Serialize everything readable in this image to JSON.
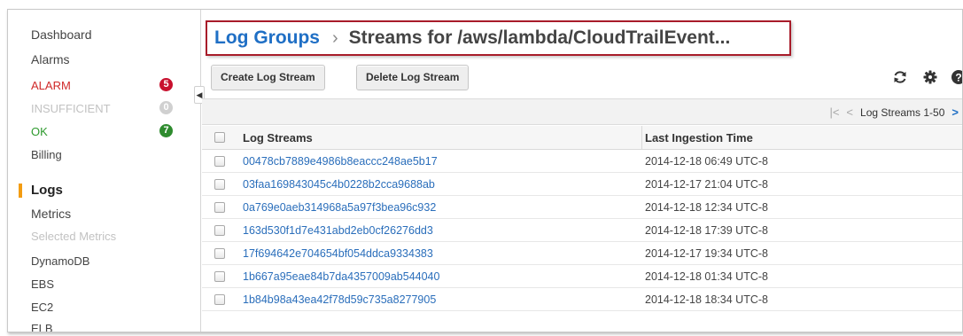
{
  "sidebar": {
    "dashboard": "Dashboard",
    "alarms": "Alarms",
    "alarm_states": [
      {
        "label": "ALARM",
        "count": "5"
      },
      {
        "label": "INSUFFICIENT",
        "count": "0"
      },
      {
        "label": "OK",
        "count": "7"
      }
    ],
    "billing": "Billing",
    "logs": "Logs",
    "metrics": "Metrics",
    "selected_metrics": "Selected Metrics",
    "metric_items": [
      "DynamoDB",
      "EBS",
      "EC2",
      "ELB"
    ],
    "collapse_glyph": "◀"
  },
  "breadcrumb": {
    "parent": "Log Groups",
    "separator": "›",
    "current": "Streams for /aws/lambda/CloudTrailEvent..."
  },
  "toolbar": {
    "create_label": "Create Log Stream",
    "delete_label": "Delete Log Stream"
  },
  "pager": {
    "first": "|<",
    "prev": "<",
    "range_label": "Log Streams 1-50",
    "next": ">"
  },
  "table": {
    "columns": [
      "Log Streams",
      "Last Ingestion Time"
    ],
    "rows": [
      {
        "stream": "00478cb7889e4986b8eaccc248ae5b17",
        "time": "2014-12-18 06:49 UTC-8"
      },
      {
        "stream": "03faa169843045c4b0228b2cca9688ab",
        "time": "2014-12-17 21:04 UTC-8"
      },
      {
        "stream": "0a769e0aeb314968a5a97f3bea96c932",
        "time": "2014-12-18 12:34 UTC-8"
      },
      {
        "stream": "163d530f1d7e431abd2eb0cf26276dd3",
        "time": "2014-12-18 17:39 UTC-8"
      },
      {
        "stream": "17f694642e704654bf054ddca9334383",
        "time": "2014-12-17 19:34 UTC-8"
      },
      {
        "stream": "1b667a95eae84b7da4357009ab544040",
        "time": "2014-12-18 01:34 UTC-8"
      },
      {
        "stream": "1b84b98a43ea42f78d59c735a8277905",
        "time": "2014-12-18 18:34 UTC-8"
      }
    ]
  },
  "colors": {
    "link": "#1f6fc5",
    "highlight_border": "#a81c2a",
    "alarm_red": "#c8102e",
    "ok_green": "#2e8b2e",
    "logs_accent": "#f39c12"
  }
}
